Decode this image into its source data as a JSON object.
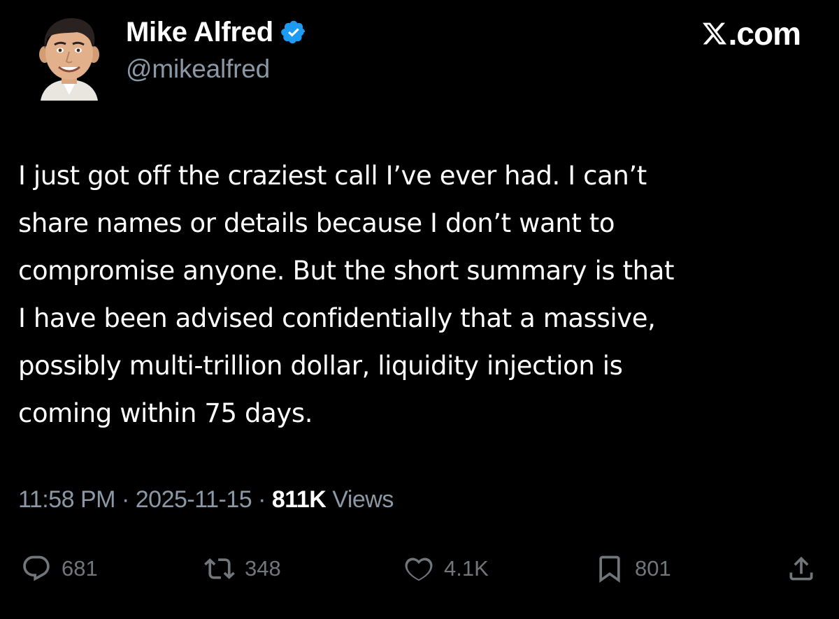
{
  "author": {
    "display_name": "Mike Alfred",
    "handle": "@mikealfred",
    "verified": true,
    "avatar": "cartoon-portrait-avatar"
  },
  "site": {
    "label": ".com",
    "logo": "x-logo"
  },
  "tweet": {
    "lines": [
      "I just got off the craziest call I’ve ever had. I can’t",
      "share names or details because I don’t want to",
      "compromise anyone. But the short summary is that",
      "I have been advised confidentially that a massive,",
      "possibly multi-trillion dollar, liquidity injection is",
      "coming within 75 days."
    ]
  },
  "meta": {
    "time": "11:58 PM",
    "separator": "·",
    "date": "2025-11-15",
    "views_count": "811K",
    "views_label": "Views"
  },
  "actions": {
    "replies": "681",
    "reposts": "348",
    "likes": "4.1K",
    "bookmarks": "801"
  },
  "colors": {
    "background": "#000000",
    "text": "#ffffff",
    "muted": "#8b98a5",
    "icon": "#71767b",
    "verified": "#1d9bf0"
  }
}
